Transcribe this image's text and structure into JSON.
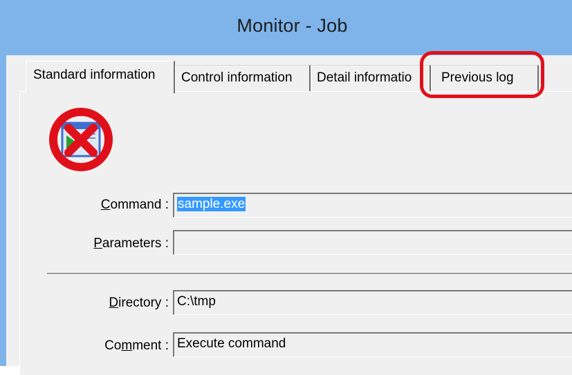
{
  "window": {
    "title": "Monitor - Job"
  },
  "tabs": [
    {
      "label": "Standard information"
    },
    {
      "label": "Control information"
    },
    {
      "label": "Detail informatio"
    },
    {
      "label": "Previous log"
    }
  ],
  "job_icon": {
    "name": "job-error-icon",
    "status_color": "#e0101a"
  },
  "form": {
    "command": {
      "label_key": "C",
      "label_rest": "ommand :",
      "value": "sample.exe",
      "selected": true
    },
    "parameters": {
      "label_key": "P",
      "label_rest": "arameters :",
      "value": ""
    },
    "directory": {
      "label_key": "D",
      "label_rest": "irectory :",
      "value": "C:\\tmp"
    },
    "comment": {
      "label_pre": "Co",
      "label_key": "m",
      "label_rest": "ment :",
      "value": "Execute command"
    }
  },
  "colors": {
    "titlebar": "#7eb4ea",
    "highlight": "#e0101a",
    "selection": "#3399ff"
  }
}
